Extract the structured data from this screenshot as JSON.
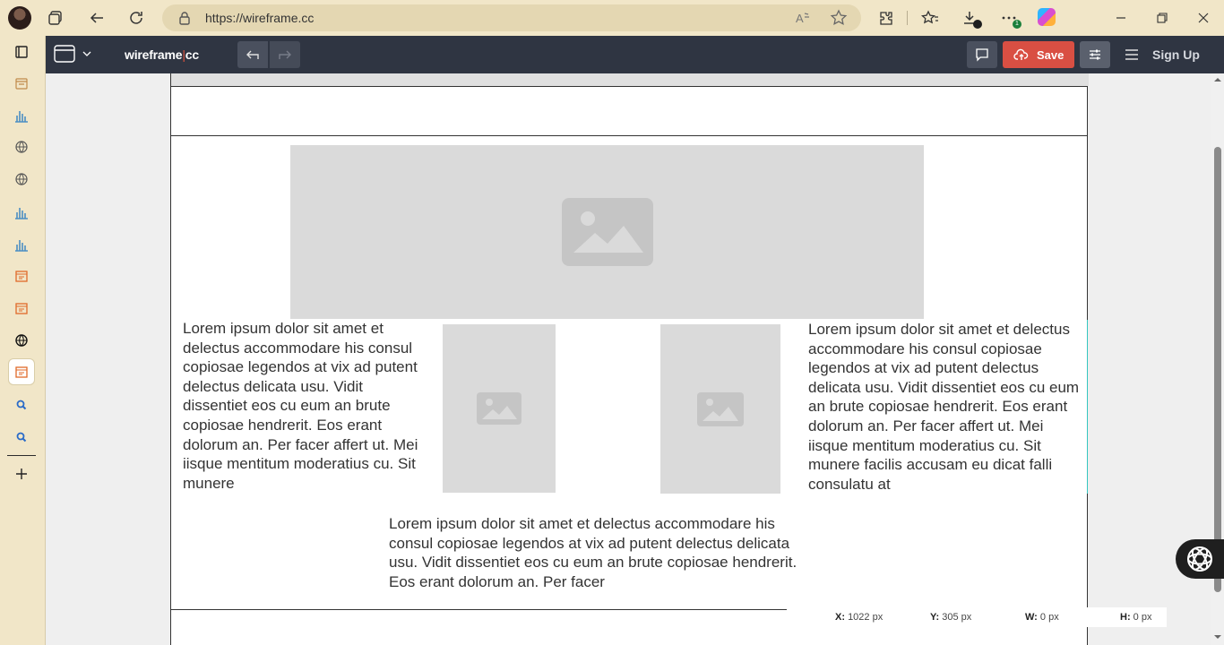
{
  "browser": {
    "url": "https://wireframe.cc",
    "download_badge": "1"
  },
  "app": {
    "brand_left": "wireframe",
    "brand_right": "cc",
    "save_label": "Save",
    "signup_label": "Sign Up"
  },
  "canvas": {
    "lorem_left": "Lorem ipsum dolor sit amet et delectus accommodare his consul copiosae legendos at vix ad putent delectus delicata usu. Vidit dissentiet eos cu eum an brute copiosae hendrerit. Eos erant dolorum an. Per facer affert ut. Mei iisque mentitum moderatius cu. Sit munere",
    "lorem_right": "Lorem ipsum dolor sit amet et delectus accommodare his consul copiosae legendos at vix ad putent delectus delicata usu. Vidit dissentiet eos cu eum an brute copiosae hendrerit. Eos erant dolorum an. Per facer affert ut. Mei iisque mentitum moderatius cu. Sit munere facilis accusam eu dicat falli consulatu at",
    "lorem_bottom": "Lorem ipsum dolor sit amet et delectus accommodare his consul copiosae legendos at vix ad putent delectus delicata usu. Vidit dissentiet eos cu eum an brute copiosae hendrerit. Eos erant dolorum an. Per facer"
  },
  "status": {
    "x_label": "X:",
    "x_value": "1022 px",
    "y_label": "Y:",
    "y_value": "305 px",
    "w_label": "W:",
    "w_value": "0 px",
    "h_label": "H:",
    "h_value": "0 px"
  },
  "icons": {
    "sidebar": [
      "workspaces-icon",
      "planner-icon",
      "chart-icon",
      "globe-icon",
      "globe-icon",
      "chart-icon",
      "chart-icon",
      "calendar-icon",
      "calendar-icon",
      "world-icon",
      "calendar-icon",
      "search-icon",
      "search-icon",
      "plus-icon"
    ]
  },
  "colors": {
    "toolbar": "#2f3542",
    "save": "#d94f43",
    "selection": "#35c6c0",
    "placeholder": "#dadada"
  }
}
